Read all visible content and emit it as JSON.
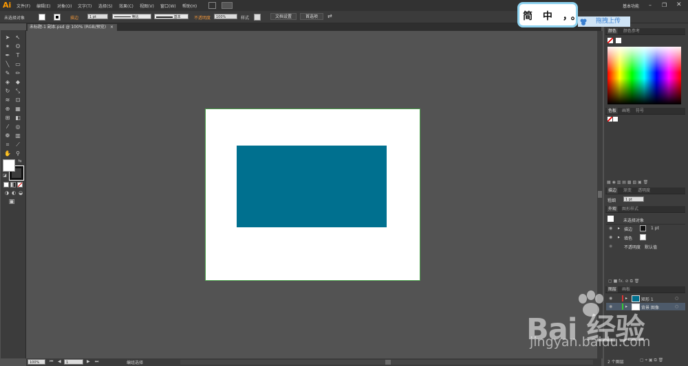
{
  "menubar": {
    "logo": "Ai",
    "items": [
      "文件(F)",
      "编辑(E)",
      "对象(O)",
      "文字(T)",
      "选择(S)",
      "效果(C)",
      "视图(V)",
      "窗口(W)",
      "帮助(H)"
    ],
    "workspace": "基本功能"
  },
  "control_bar": {
    "selection": "未选择对象",
    "stroke_label": "描边",
    "stroke_weight": "1 pt",
    "profile": "等比",
    "brush": "基本",
    "opacity_label": "不透明度",
    "opacity_value": "100%",
    "style_label": "样式",
    "doc_setup_button": "文档设置",
    "prefs_button": "首选项"
  },
  "document": {
    "tab_title": "未标题-1 副本.psd @ 100% (RGB/预览)",
    "artboard_color": "#ffffff",
    "rect_color": "#00708f"
  },
  "status": {
    "zoom": "100%",
    "page": "1",
    "tool": "编组选择"
  },
  "panels": {
    "color": {
      "tabs": [
        "颜色",
        "颜色参考"
      ]
    },
    "swatches": {
      "tabs": [
        "色板",
        "画笔",
        "符号"
      ]
    },
    "stroke": {
      "tabs": [
        "描边",
        "渐变",
        "透明度"
      ],
      "weight_label": "粗细",
      "weight_value": "1 pt"
    },
    "appearance": {
      "tabs": [
        "外观",
        "图形样式"
      ],
      "title": "未选择对象",
      "rows": [
        {
          "label": "描边",
          "value": "1 pt"
        },
        {
          "label": "填色",
          "value": ""
        },
        {
          "label": "不透明度",
          "value": "默认值"
        }
      ]
    },
    "layers": {
      "tabs": [
        "图层",
        "画板"
      ],
      "rows": [
        {
          "name": "矩形 1"
        },
        {
          "name": "背景 图像"
        }
      ],
      "footer": "2 个图层"
    }
  },
  "overlay": {
    "popup_text": "简 中 ，。",
    "drag_upload": "拖拽上传"
  },
  "watermark": {
    "brand": "Bai  经验",
    "url": "jingyan.baidu.com"
  }
}
